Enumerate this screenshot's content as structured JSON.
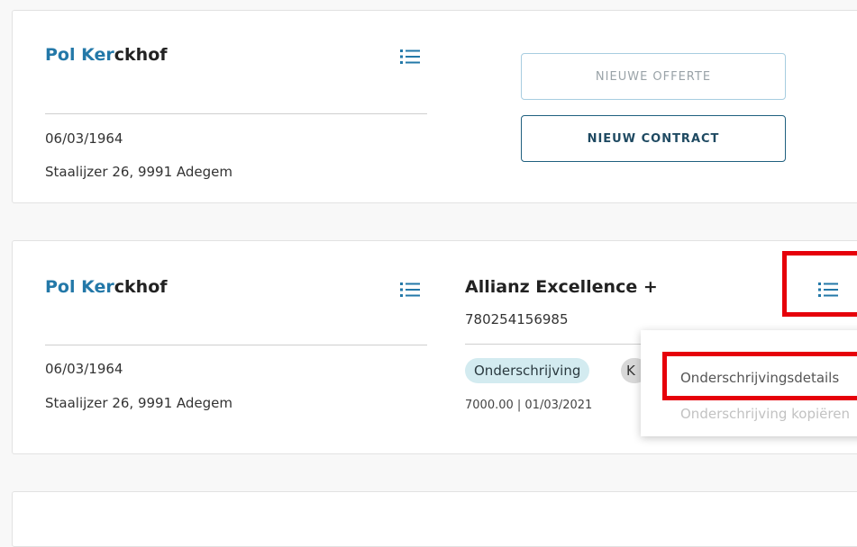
{
  "cards": [
    {
      "customer": {
        "name_highlight_first": "Pol",
        "name_highlight_last": "Ker",
        "name_rest": "ckhof",
        "birthdate": "06/03/1964",
        "address": "Staalijzer 26, 9991  Adegem"
      },
      "actions": {
        "new_quote_label": "NIEUWE OFFERTE",
        "new_contract_label": "NIEUW CONTRACT"
      }
    },
    {
      "customer": {
        "name_highlight_first": "Pol",
        "name_highlight_last": "Ker",
        "name_rest": "ckhof",
        "birthdate": "06/03/1964",
        "address": "Staalijzer 26, 9991  Adegem"
      },
      "contract": {
        "product": "Allianz Excellence +",
        "policy_number": "780254156985",
        "status_badge": "Onderschrijving",
        "secondary_badge": "K",
        "amount_date": "7000.00 | 01/03/2021"
      },
      "menu": {
        "items": [
          "Onderschrijvingsdetails",
          "Onderschrijving kopiëren"
        ]
      }
    }
  ],
  "icons": {
    "list": "list-icon"
  },
  "colors": {
    "highlight": "#2378a8",
    "primary_border": "#20607f",
    "disabled_border": "#a7cde0",
    "badge_teal": "#d3ebf0",
    "annotation_red": "#e6000a"
  }
}
